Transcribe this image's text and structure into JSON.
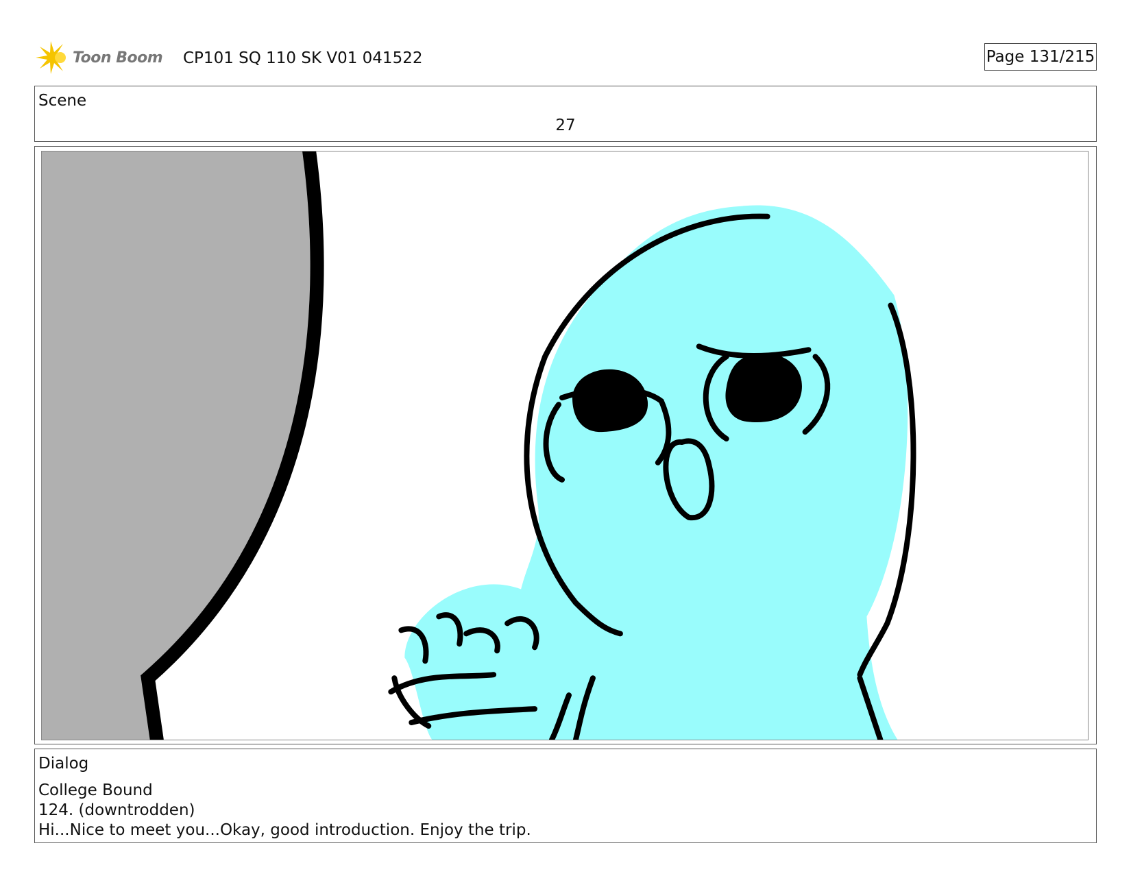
{
  "header": {
    "logo_text": "Toon Boom",
    "document_title": "CP101 SQ 110 SK V01 041522",
    "page_indicator": "Page 131/215"
  },
  "scene": {
    "label": "Scene",
    "number": "27"
  },
  "dialog": {
    "label": "Dialog",
    "lines": [
      "College Bound",
      "124. (downtrodden)",
      "Hi...Nice to meet you...Okay, good introduction. Enjoy the trip."
    ]
  },
  "colors": {
    "character_fill": "#99fcfc",
    "curtain_fill": "#b0b0b0",
    "logo_accent": "#f5c400"
  },
  "icons": {
    "logo": "toon-boom-starburst-icon"
  }
}
